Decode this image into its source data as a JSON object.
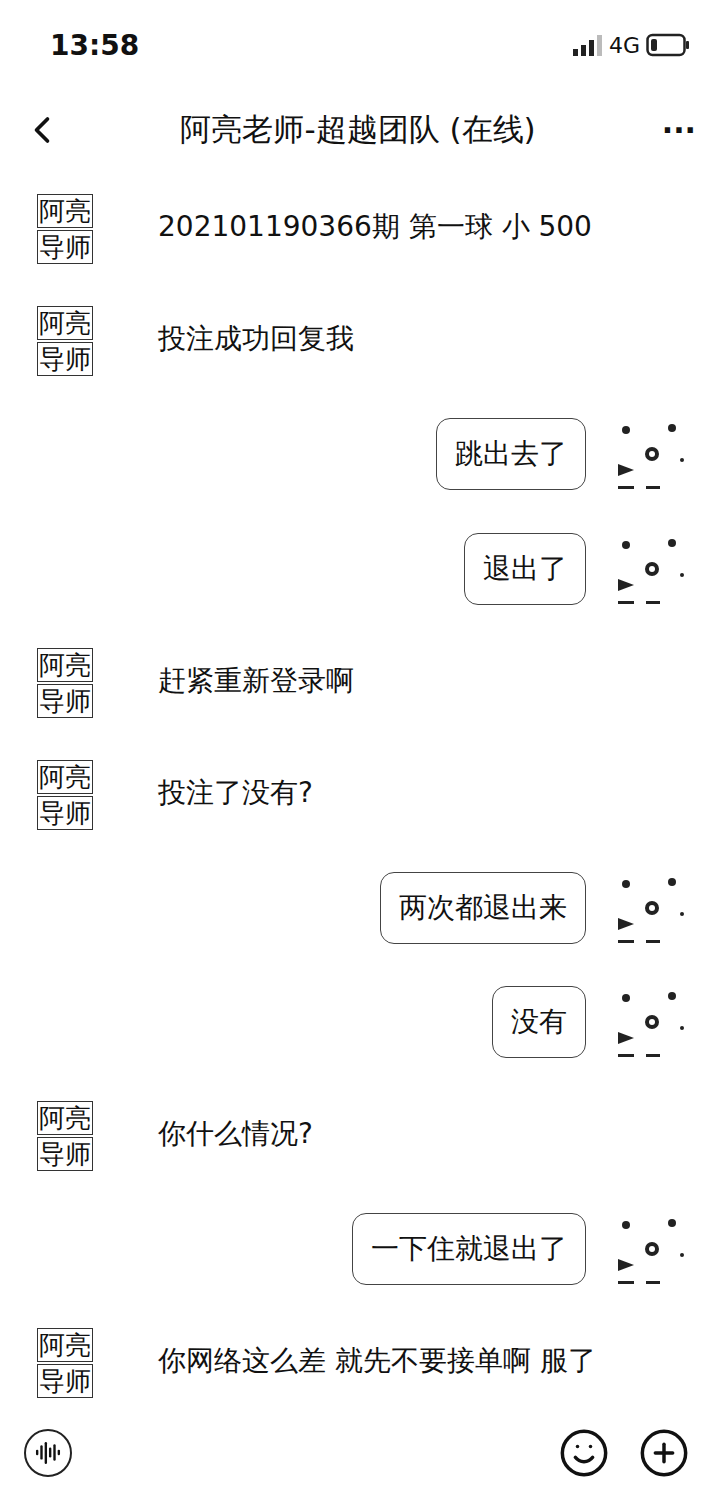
{
  "status_bar": {
    "time": "13:58",
    "network": "4G"
  },
  "header": {
    "back": "<",
    "title": "阿亮老师-超越团队 (在线)",
    "menu": "···"
  },
  "contact_avatar": {
    "line1": "阿亮",
    "line2": "导师"
  },
  "messages": [
    {
      "kind": "incoming",
      "text": "202101190366期 第一球 小 500"
    },
    {
      "kind": "incoming",
      "text": "投注成功回复我"
    },
    {
      "kind": "outgoing",
      "text": "跳出去了"
    },
    {
      "kind": "outgoing",
      "text": "退出了"
    },
    {
      "kind": "incoming",
      "text": "赶紧重新登录啊"
    },
    {
      "kind": "incoming",
      "text": "投注了没有?"
    },
    {
      "kind": "outgoing",
      "text": "两次都退出来"
    },
    {
      "kind": "outgoing",
      "text": "没有"
    },
    {
      "kind": "incoming",
      "text": "你什么情况?"
    },
    {
      "kind": "outgoing",
      "text": "一下住就退出了"
    },
    {
      "kind": "incoming",
      "text": "你网络这么差 就先不要接单啊 服了"
    }
  ]
}
